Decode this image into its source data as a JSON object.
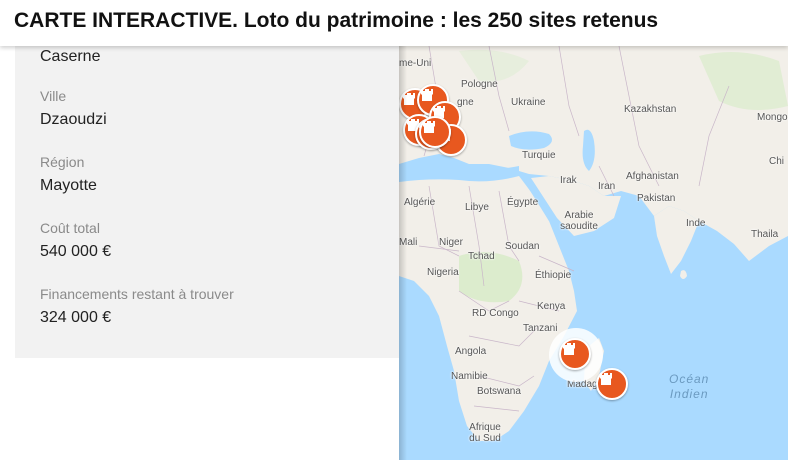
{
  "header": {
    "title": "CARTE INTERACTIVE. Loto du patrimoine : les 250 sites retenus"
  },
  "info_panel": {
    "type_value": "Caserne",
    "fields": [
      {
        "label": "Ville",
        "value": "Dzaoudzi"
      },
      {
        "label": "Région",
        "value": "Mayotte"
      },
      {
        "label": "Coût total",
        "value": "540 000 €"
      },
      {
        "label": "Financements restant à trouver",
        "value": "324 000 €"
      }
    ]
  },
  "map": {
    "country_labels": [
      "me-Uni",
      "Pologne",
      "Ukraine",
      "Kazakhstan",
      "Mongo",
      "gne",
      "Turquie",
      "Chi",
      "Irak",
      "Iran",
      "Afghanistan",
      "Pakistan",
      "Algérie",
      "Libye",
      "Égypte",
      "Arabie saoudite",
      "Inde",
      "Thaila",
      "Mali",
      "Niger",
      "Soudan",
      "Tchad",
      "Nigeria",
      "Éthiopie",
      "Kenya",
      "RD Congo",
      "Tanzani",
      "Angola",
      "Namibie",
      "Botswana",
      "Madaga",
      "Afrique du Sud"
    ],
    "ocean_label": [
      "Océan",
      "Indien"
    ],
    "marker_icon": "castle-icon",
    "colors": {
      "water": "#aadaff",
      "land": "#f2efe9",
      "marker": "#e8581f"
    }
  }
}
